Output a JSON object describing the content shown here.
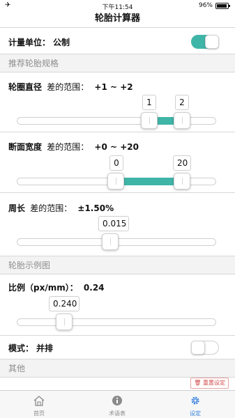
{
  "status_bar": {
    "time": "下午11:54",
    "battery": "96%"
  },
  "nav": {
    "title": "轮胎计算器"
  },
  "unit": {
    "label": "计量单位：",
    "value": "公制",
    "toggle_on": true
  },
  "sections": {
    "recommend": "推荐轮胎规格",
    "example": "轮胎示例图",
    "other": "其他"
  },
  "rim": {
    "label": "轮圈直径",
    "range_prefix": "差的范围：",
    "range": "+1 ~ +2",
    "low": "1",
    "high": "2",
    "low_fraction": 0.66,
    "high_fraction": 0.82
  },
  "width": {
    "label": "断面宽度",
    "range_prefix": "差的范围：",
    "range": "+0 ~ +20",
    "low": "0",
    "high": "20",
    "low_fraction": 0.47,
    "high_fraction": 0.82
  },
  "circ": {
    "label": "周长",
    "range_prefix": "差的范围：",
    "range": "±1.50%",
    "value": "0.015",
    "fraction": 0.46
  },
  "ratio": {
    "label": "比例（px/mm）：",
    "value_text": "0.24",
    "value": "0.240",
    "fraction": 0.22
  },
  "mode": {
    "label": "模式：",
    "value": "并排",
    "toggle_on": false
  },
  "reset": {
    "label": "重置设定"
  },
  "tabs": [
    {
      "label": "首页",
      "icon": "home-icon"
    },
    {
      "label": "术语表",
      "icon": "info-icon"
    },
    {
      "label": "设定",
      "icon": "gear-icon",
      "active": true
    }
  ]
}
